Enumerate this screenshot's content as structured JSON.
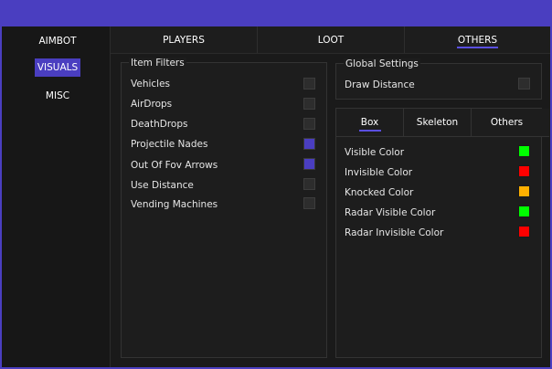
{
  "sidebar": {
    "items": [
      {
        "label": "AIMBOT",
        "active": false
      },
      {
        "label": "VISUALS",
        "active": true
      },
      {
        "label": "MISC",
        "active": false
      }
    ]
  },
  "tabs": {
    "items": [
      {
        "label": "PLAYERS",
        "active": false
      },
      {
        "label": "LOOT",
        "active": false
      },
      {
        "label": "OTHERS",
        "active": true
      }
    ]
  },
  "item_filters": {
    "title": "Item Filters",
    "rows": [
      {
        "label": "Vehicles",
        "checked": false
      },
      {
        "label": "AirDrops",
        "checked": false
      },
      {
        "label": "DeathDrops",
        "checked": false
      },
      {
        "label": "Projectile Nades",
        "checked": true
      },
      {
        "label": "Out Of Fov Arrows",
        "checked": true
      },
      {
        "label": "Use Distance",
        "checked": false
      },
      {
        "label": "Vending Machines",
        "checked": false
      }
    ]
  },
  "global_settings": {
    "title": "Global Settings",
    "rows": [
      {
        "label": "Draw Distance",
        "checked": false
      }
    ]
  },
  "sub_tabs": {
    "items": [
      {
        "label": "Box",
        "active": true
      },
      {
        "label": "Skeleton",
        "active": false
      },
      {
        "label": "Others",
        "active": false
      }
    ]
  },
  "colors": {
    "rows": [
      {
        "label": "Visible Color",
        "color": "#00ff00"
      },
      {
        "label": "Invisible Color",
        "color": "#ff0000"
      },
      {
        "label": "Knocked Color",
        "color": "#ffb000"
      },
      {
        "label": "Radar Visible Color",
        "color": "#00ff00"
      },
      {
        "label": "Radar Invisible Color",
        "color": "#ff0000"
      }
    ]
  },
  "theme": {
    "accent": "#4a3ec0",
    "background": "#1a1a1a"
  }
}
